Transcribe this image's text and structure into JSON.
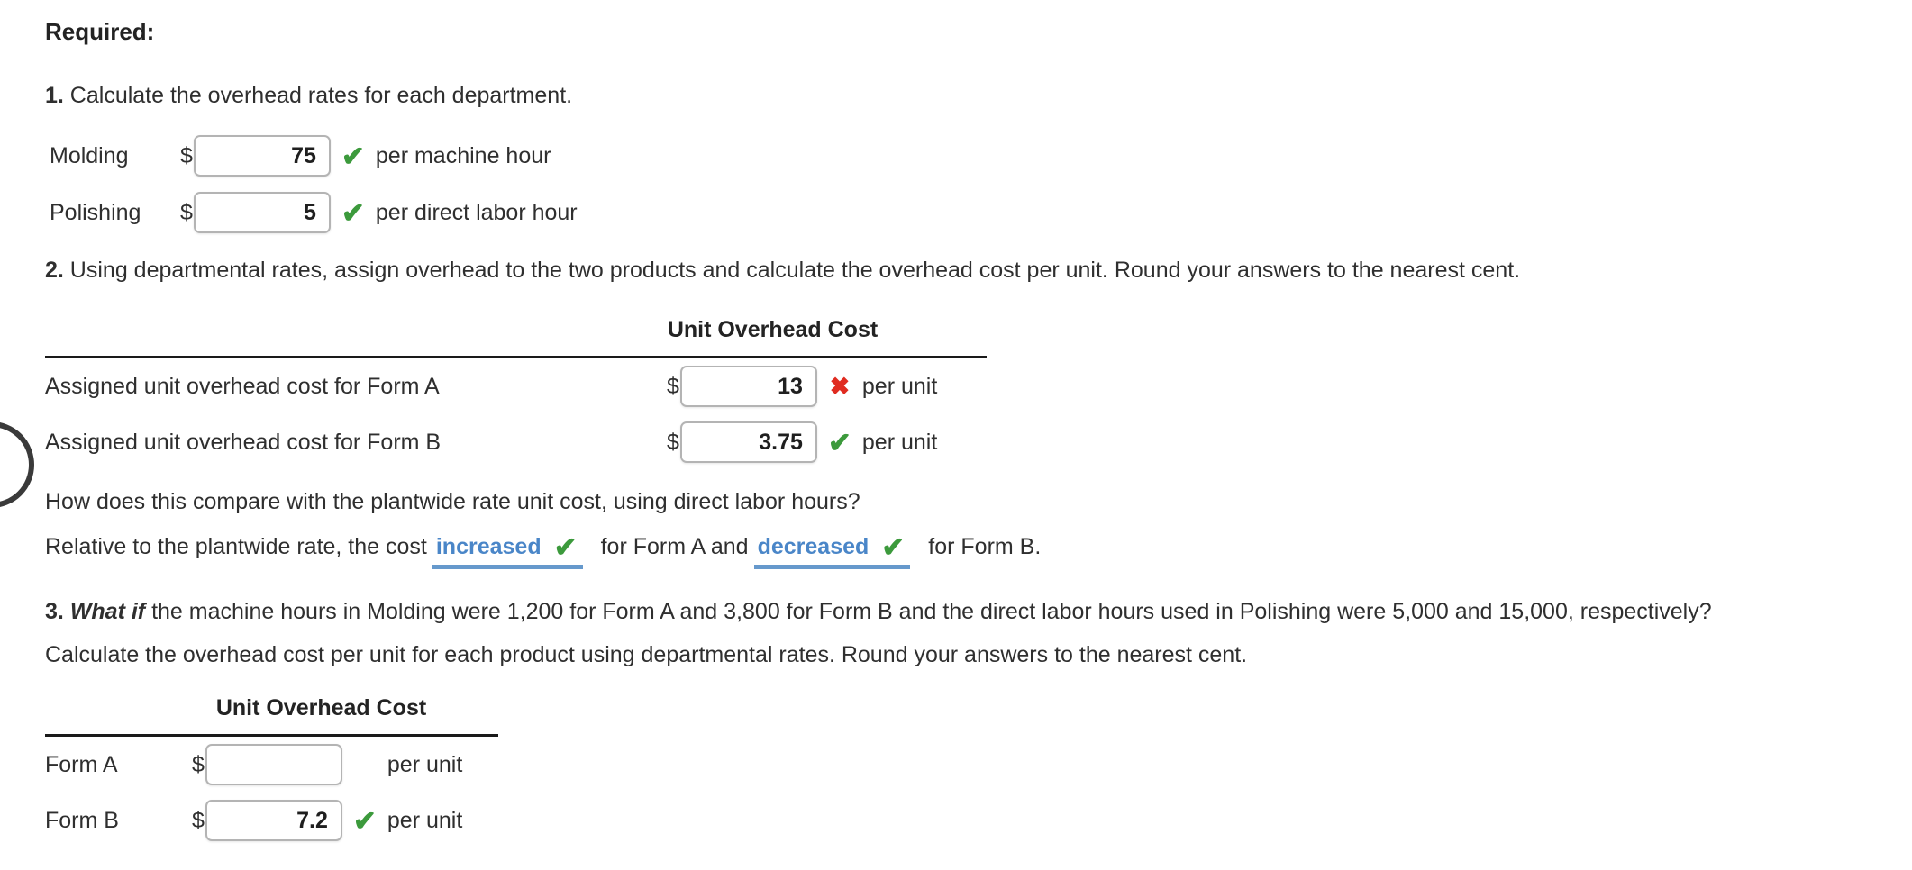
{
  "headings": {
    "required": "Required:"
  },
  "q1": {
    "number": "1.",
    "text": " Calculate the overhead rates for each department.",
    "rows": [
      {
        "label": "Molding",
        "currency": "$",
        "value": "75",
        "mark": "check",
        "mark_glyph": "✔",
        "suffix": "per machine hour"
      },
      {
        "label": "Polishing",
        "currency": "$",
        "value": "5",
        "mark": "check",
        "mark_glyph": "✔",
        "suffix": "per direct labor hour"
      }
    ]
  },
  "q2": {
    "number": "2.",
    "text": " Using departmental rates, assign overhead to the two products and calculate the overhead cost per unit. Round your answers to the nearest cent.",
    "table": {
      "header": "Unit Overhead Cost",
      "rows": [
        {
          "label": "Assigned unit overhead cost for Form A",
          "currency": "$",
          "value": "13",
          "mark": "cross",
          "mark_glyph": "✖",
          "suffix": "per unit"
        },
        {
          "label": "Assigned unit overhead cost for Form B",
          "currency": "$",
          "value": "3.75",
          "mark": "check",
          "mark_glyph": "✔",
          "suffix": "per unit"
        }
      ]
    },
    "compare_question": "How does this compare with the plantwide rate unit cost, using direct labor hours?",
    "compare_answer": {
      "lead": "Relative to the plantwide rate, the cost",
      "dropdown_a": "increased",
      "dropdown_a_mark": "✔",
      "middle": "for Form A and",
      "dropdown_b": "decreased",
      "dropdown_b_mark": "✔",
      "trail": "for Form B."
    }
  },
  "q3": {
    "number": "3.",
    "emphasis": "What if",
    "text_line1": " the machine hours in Molding were 1,200 for Form A and 3,800 for Form B and the direct labor hours used in Polishing were 5,000 and 15,000, respectively?",
    "text_line2": "Calculate the overhead cost per unit for each product using departmental rates. Round your answers to the nearest cent.",
    "table": {
      "header": "Unit Overhead Cost",
      "rows": [
        {
          "label": "Form A",
          "currency": "$",
          "value": "",
          "mark": "blank",
          "mark_glyph": "",
          "suffix": "per unit"
        },
        {
          "label": "Form B",
          "currency": "$",
          "value": "7.2",
          "mark": "check",
          "mark_glyph": "✔",
          "suffix": "per unit"
        }
      ]
    }
  },
  "colors": {
    "correct": "#3c9a3c",
    "incorrect": "#e02b20",
    "dropdown_text": "#4a86c8",
    "dropdown_underline": "#6699cc",
    "text": "#2f2f2f",
    "rule": "#1a1a1a",
    "input_border": "#b4b4b4"
  }
}
